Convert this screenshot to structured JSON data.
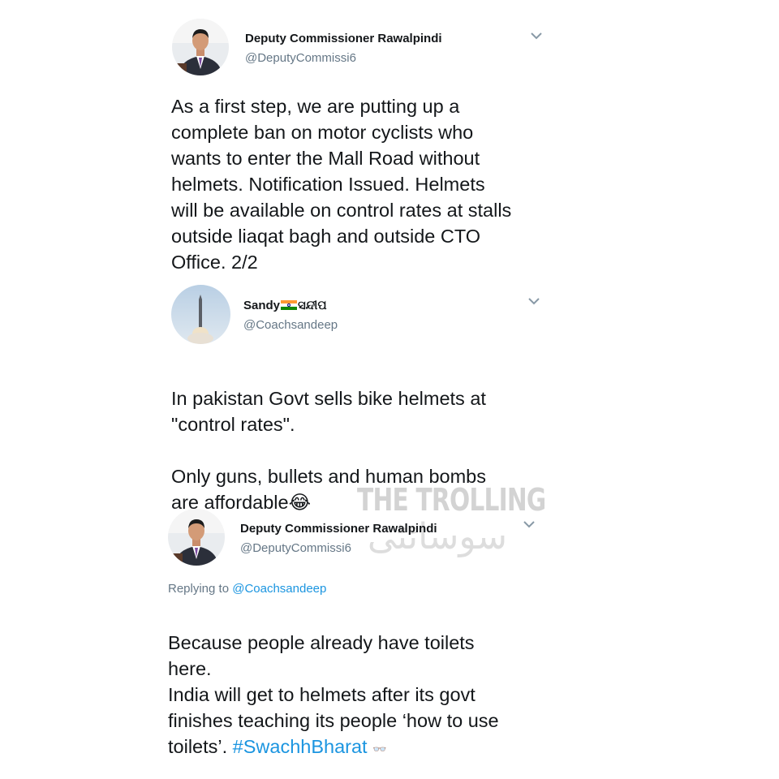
{
  "tweets": [
    {
      "author_name": "Deputy Commissioner Rawalpindi",
      "handle": "@DeputyCommissi6",
      "text": "As a first step, we are putting up a\ncomplete ban on motor cyclists who\nwants to enter the Mall Road without\nhelmets. Notification Issued. Helmets\nwill be available on control rates at stalls\noutside liaqat bagh and outside CTO\nOffice. 2/2",
      "avatar_icon": "man-in-suit-avatar"
    },
    {
      "author_name": "Sandy",
      "name_suffix": "ସନ୍ଦୀପ",
      "handle": "@Coachsandeep",
      "text": "In pakistan Govt sells bike helmets at\n\"control rates\".\n\nOnly guns, bullets and human bombs\nare affordable",
      "emoji": "😂",
      "avatar_icon": "rocket-launch-avatar"
    },
    {
      "author_name": "Deputy Commissioner Rawalpindi",
      "handle": "@DeputyCommissi6",
      "reply_prefix": "Replying to ",
      "reply_handle": "@Coachsandeep",
      "text": "Because people already have toilets\nhere.\nIndia will get to helmets after its govt\nfinishes teaching its people ‘how to use\ntoilets’. ",
      "hashtag": "#SwachhBharat",
      "trailing_emoji": "👓",
      "avatar_icon": "man-in-suit-avatar"
    }
  ],
  "watermark": {
    "title": "THE TROLLING",
    "urdu": "سوسائٹی"
  },
  "colors": {
    "link": "#1b95e0",
    "secondary_text": "#657786",
    "primary_text": "#14171a"
  }
}
